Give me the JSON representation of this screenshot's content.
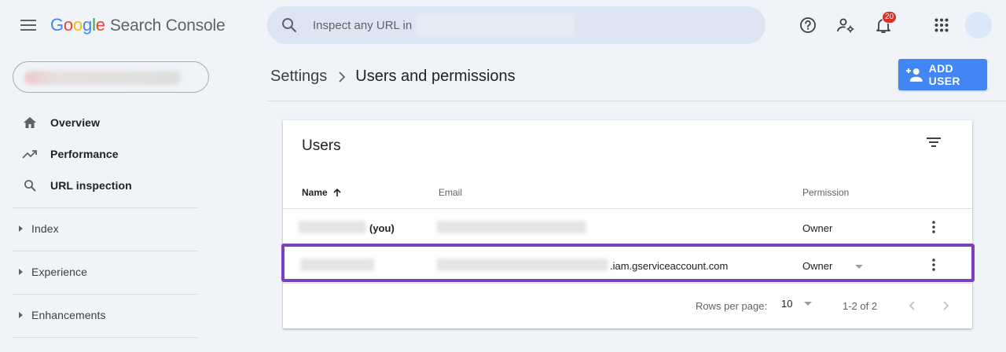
{
  "header": {
    "logo": {
      "g1": "G",
      "o1": "o",
      "o2": "o",
      "g2": "g",
      "l": "l",
      "e": "e",
      "product": "Search Console"
    },
    "search": {
      "placeholder": "Inspect any URL in"
    },
    "notifications": {
      "count": "20"
    },
    "icons": [
      "menu-icon",
      "search-icon",
      "help-icon",
      "manage-accounts-icon",
      "notifications-bell-icon",
      "apps-grid-icon",
      "avatar"
    ]
  },
  "sidebar": {
    "nav": [
      {
        "label": "Overview",
        "icon": "home-icon"
      },
      {
        "label": "Performance",
        "icon": "trending-up-icon"
      },
      {
        "label": "URL inspection",
        "icon": "search-icon"
      }
    ],
    "sections": [
      {
        "label": "Index"
      },
      {
        "label": "Experience"
      },
      {
        "label": "Enhancements"
      }
    ]
  },
  "page": {
    "breadcrumb": {
      "parent": "Settings",
      "current": "Users and permissions"
    },
    "add_user_label": "ADD USER"
  },
  "users_card": {
    "title": "Users",
    "columns": {
      "name": "Name",
      "email": "Email",
      "permission": "Permission"
    },
    "rows": [
      {
        "name_suffix": "(you)",
        "email_suffix": "",
        "permission": "Owner"
      },
      {
        "name_suffix": "",
        "email_suffix": ".iam.gserviceaccount.com",
        "permission": "Owner"
      }
    ],
    "footer": {
      "rows_per_page_label": "Rows per page:",
      "rows_per_page_value": "10",
      "range": "1-2 of 2"
    }
  },
  "colors": {
    "accent": "#4285f4",
    "highlight": "#7c3fbf",
    "badge": "#d93025",
    "background": "#f0f4f9"
  }
}
